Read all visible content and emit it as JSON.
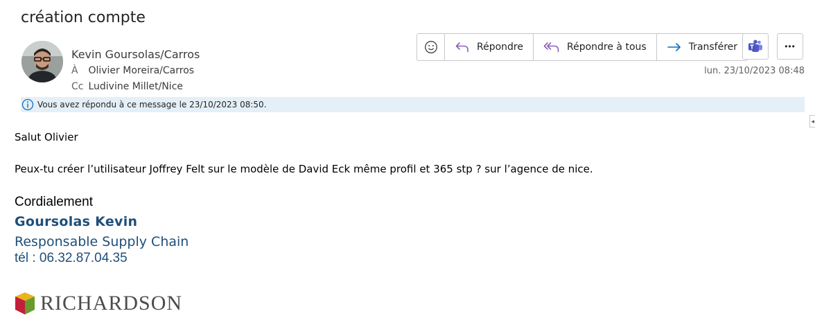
{
  "message": {
    "subject": "création compte",
    "sender": "Kevin Goursolas/Carros",
    "to_prefix": "À",
    "to": "Olivier Moreira/Carros",
    "cc_prefix": "Cc",
    "cc": "Ludivine Millet/Nice",
    "date": "lun. 23/10/2023 08:48",
    "info_banner": "Vous avez répondu à ce message le 23/10/2023 08:50."
  },
  "actions": {
    "reply": "Répondre",
    "reply_all": "Répondre à tous",
    "forward": "Transférer",
    "emoji_icon": "smiley-icon",
    "teams_icon": "teams-icon",
    "more": "•••"
  },
  "body": {
    "greeting": "Salut Olivier",
    "paragraph": "Peux-tu créer l’utilisateur Joffrey Felt sur le modèle de David Eck même profil et 365 stp ? sur l’agence de nice."
  },
  "signature": {
    "regards": "Cordialement",
    "name": "Goursolas Kevin",
    "role": "Responsable Supply Chain",
    "phone": "tél : 06.32.87.04.35",
    "logo_text": "RICHARDSON"
  },
  "colors": {
    "accent_purple": "#8b5fb8",
    "accent_blue": "#0f6cbd",
    "signature_blue": "#1f4e79",
    "info_bar": "#e4eff7",
    "teams": "#5059c9"
  }
}
